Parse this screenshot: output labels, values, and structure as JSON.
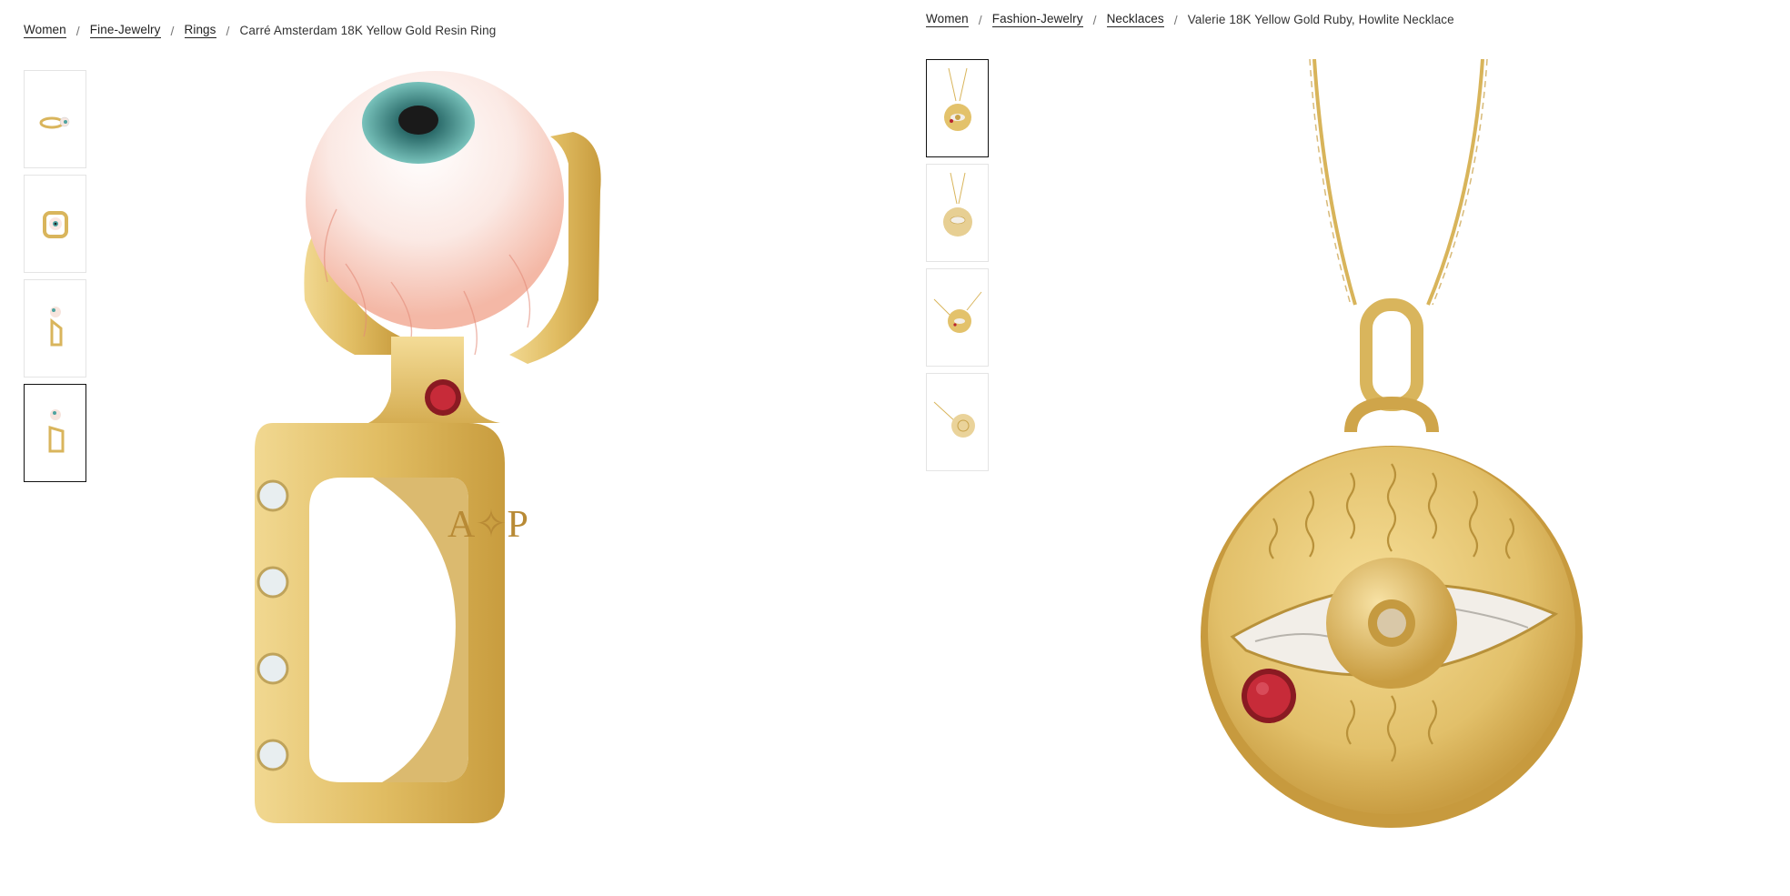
{
  "left_product": {
    "breadcrumb": {
      "links": [
        "Women",
        "Fine-Jewelry",
        "Rings"
      ],
      "current": "Carré Amsterdam 18K Yellow Gold Resin Ring"
    },
    "thumbnails": [
      "ring-front-view",
      "ring-top-view",
      "ring-side-view",
      "ring-angle-view"
    ],
    "active_thumbnail": 4,
    "main_image": "eyeball-ring-photo",
    "engraving": "A✧P"
  },
  "right_product": {
    "breadcrumb": {
      "links": [
        "Women",
        "Fashion-Jewelry",
        "Necklaces"
      ],
      "current": "Valerie 18K Yellow Gold Ruby, Howlite Necklace"
    },
    "thumbnails": [
      "necklace-front-view",
      "necklace-flat-view",
      "necklace-angle-view",
      "necklace-back-view"
    ],
    "active_thumbnail": 1,
    "main_image": "eye-pendant-necklace-photo"
  },
  "colors": {
    "gold": "#e2c06a",
    "gold_dark": "#b8913a",
    "ruby": "#b8232f",
    "iris": "#4fa3a0",
    "border_active": "#111111"
  }
}
